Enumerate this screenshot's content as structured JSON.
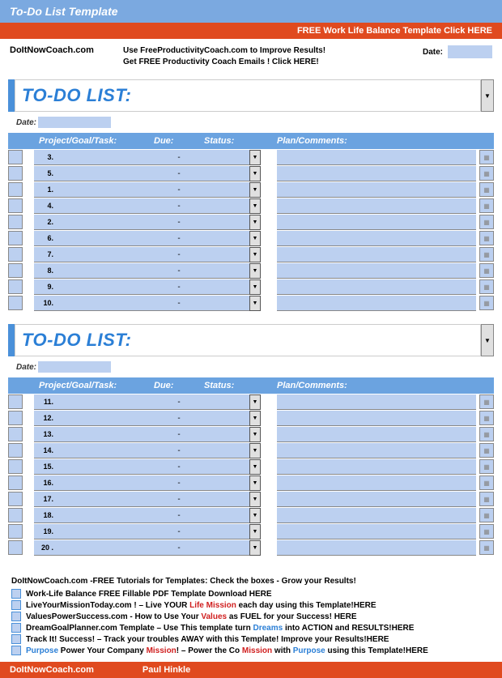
{
  "header": {
    "title": "To-Do List Template"
  },
  "banner": {
    "text": "FREE Work Life Balance Template Click HERE"
  },
  "info": {
    "site": "DoItNowCoach.com",
    "line1": "Use FreeProductivityCoach.com  to Improve Results!",
    "line2": "Get FREE Productivity Coach Emails !    Click HERE!",
    "date_label": "Date:"
  },
  "lists": [
    {
      "title": "TO-DO LIST:",
      "date_label": "Date:",
      "columns": {
        "task": "Project/Goal/Task:",
        "due": "Due:",
        "status": "Status:",
        "plan": "Plan/Comments:"
      },
      "rows": [
        {
          "num": "3."
        },
        {
          "num": "5."
        },
        {
          "num": "1."
        },
        {
          "num": "4."
        },
        {
          "num": "2."
        },
        {
          "num": "6."
        },
        {
          "num": "7."
        },
        {
          "num": "8."
        },
        {
          "num": "9."
        },
        {
          "num": "10."
        }
      ]
    },
    {
      "title": "TO-DO LIST:",
      "date_label": "Date:",
      "columns": {
        "task": "Project/Goal/Task:",
        "due": "Due:",
        "status": "Status:",
        "plan": "Plan/Comments:"
      },
      "rows": [
        {
          "num": "11."
        },
        {
          "num": "12."
        },
        {
          "num": "13."
        },
        {
          "num": "14."
        },
        {
          "num": "15."
        },
        {
          "num": "16."
        },
        {
          "num": "17."
        },
        {
          "num": "18."
        },
        {
          "num": "19."
        },
        {
          "num": "20 ."
        }
      ]
    }
  ],
  "tutorials": {
    "heading": "DoItNowCoach.com -FREE Tutorials for Templates:     Check the boxes - Grow your Results!",
    "items": [
      {
        "parts": [
          {
            "t": "Work-Life Balance FREE Fillable PDF Template  Download HERE"
          }
        ]
      },
      {
        "parts": [
          {
            "t": "LiveYourMissionToday.com ! – Live YOUR "
          },
          {
            "t": "Life Mission",
            "c": "red"
          },
          {
            "t": " each day using this Template!HERE"
          }
        ]
      },
      {
        "parts": [
          {
            "t": "ValuesPowerSuccess.com - How to Use Your "
          },
          {
            "t": "Values",
            "c": "red"
          },
          {
            "t": " as FUEL for your Success! HERE"
          }
        ]
      },
      {
        "parts": [
          {
            "t": "DreamGoalPlanner.com Template – Use This template turn "
          },
          {
            "t": "Dreams",
            "c": "blue"
          },
          {
            "t": " into ACTION and RESULTS!HERE"
          }
        ]
      },
      {
        "parts": [
          {
            "t": "Track It! Success! – Track your troubles AWAY with this Template! Improve your Results!HERE"
          }
        ]
      },
      {
        "parts": [
          {
            "t": "Purpose",
            "c": "blue"
          },
          {
            "t": " Power Your Company "
          },
          {
            "t": "Mission",
            "c": "red"
          },
          {
            "t": "! – Power the Co "
          },
          {
            "t": "Mission",
            "c": "red"
          },
          {
            "t": " with "
          },
          {
            "t": "Purpose",
            "c": "blue"
          },
          {
            "t": " using this Template!HERE"
          }
        ]
      }
    ]
  },
  "footer": {
    "site": "DoItNowCoach.com",
    "author": "Paul Hinkle"
  }
}
